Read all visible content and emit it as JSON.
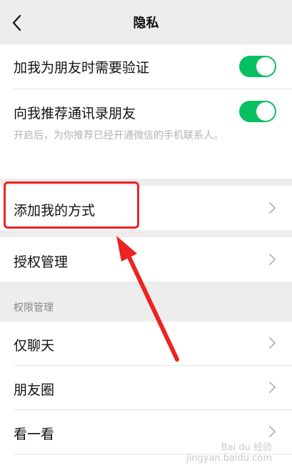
{
  "nav": {
    "title": "隐私"
  },
  "rows": {
    "verify": {
      "label": "加我为朋友时需要验证",
      "on": true
    },
    "recommend": {
      "label": "向我推荐通讯录朋友",
      "on": true,
      "desc": "开启后，为你推荐已经开通微信的手机联系人。"
    },
    "add_methods": {
      "label": "添加我的方式"
    },
    "auth_manage": {
      "label": "授权管理"
    }
  },
  "permissions": {
    "header": "权限管理",
    "items": [
      {
        "label": "仅聊天"
      },
      {
        "label": "朋友圈"
      },
      {
        "label": "看一看"
      }
    ]
  },
  "colors": {
    "accent": "#07c160",
    "highlight": "#ee2222"
  },
  "watermark": {
    "line1": "Bai du 经验",
    "line2": "jingyan.baidu.com"
  }
}
